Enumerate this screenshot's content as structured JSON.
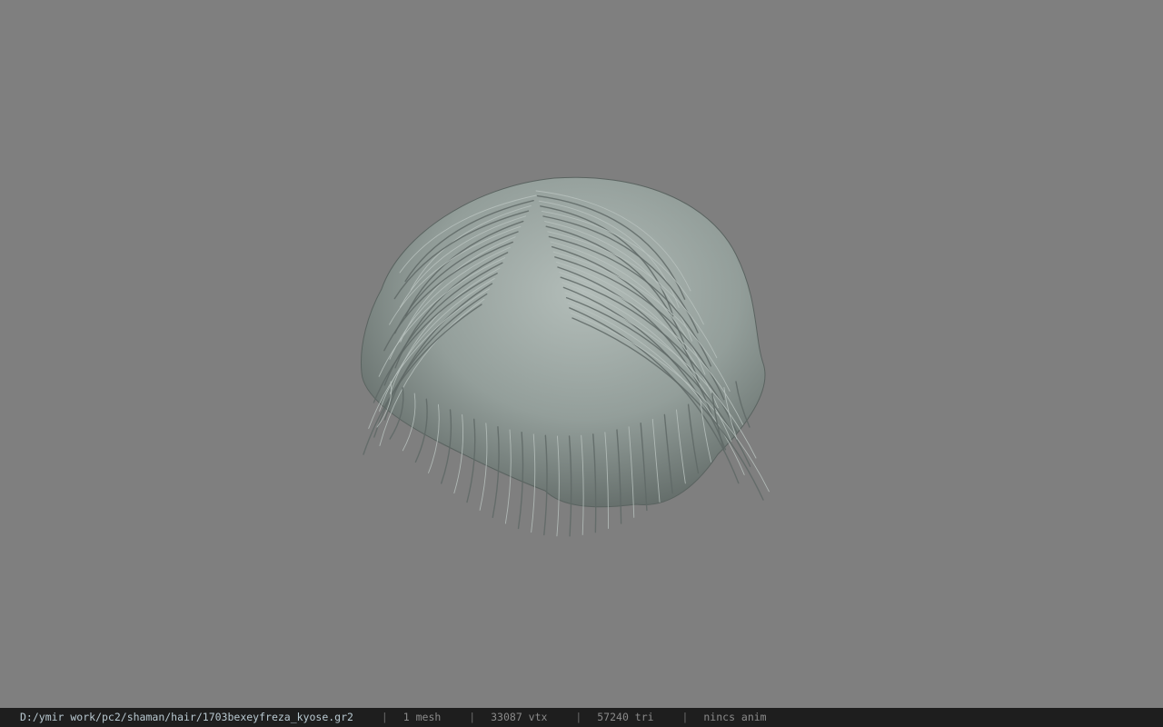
{
  "viewport": {
    "background": "#7f7f7f",
    "model_name": "hair-mesh",
    "hair_color": "#97a29e"
  },
  "statusbar": {
    "file_path": "D:/ymir work/pc2/shaman/hair/1703bexeyfreza_kyose.gr2",
    "separator": "|",
    "mesh_count": "1 mesh",
    "vertex_count": "33087 vtx",
    "triangle_count": "57240 tri",
    "anim_status": "nincs anim"
  }
}
